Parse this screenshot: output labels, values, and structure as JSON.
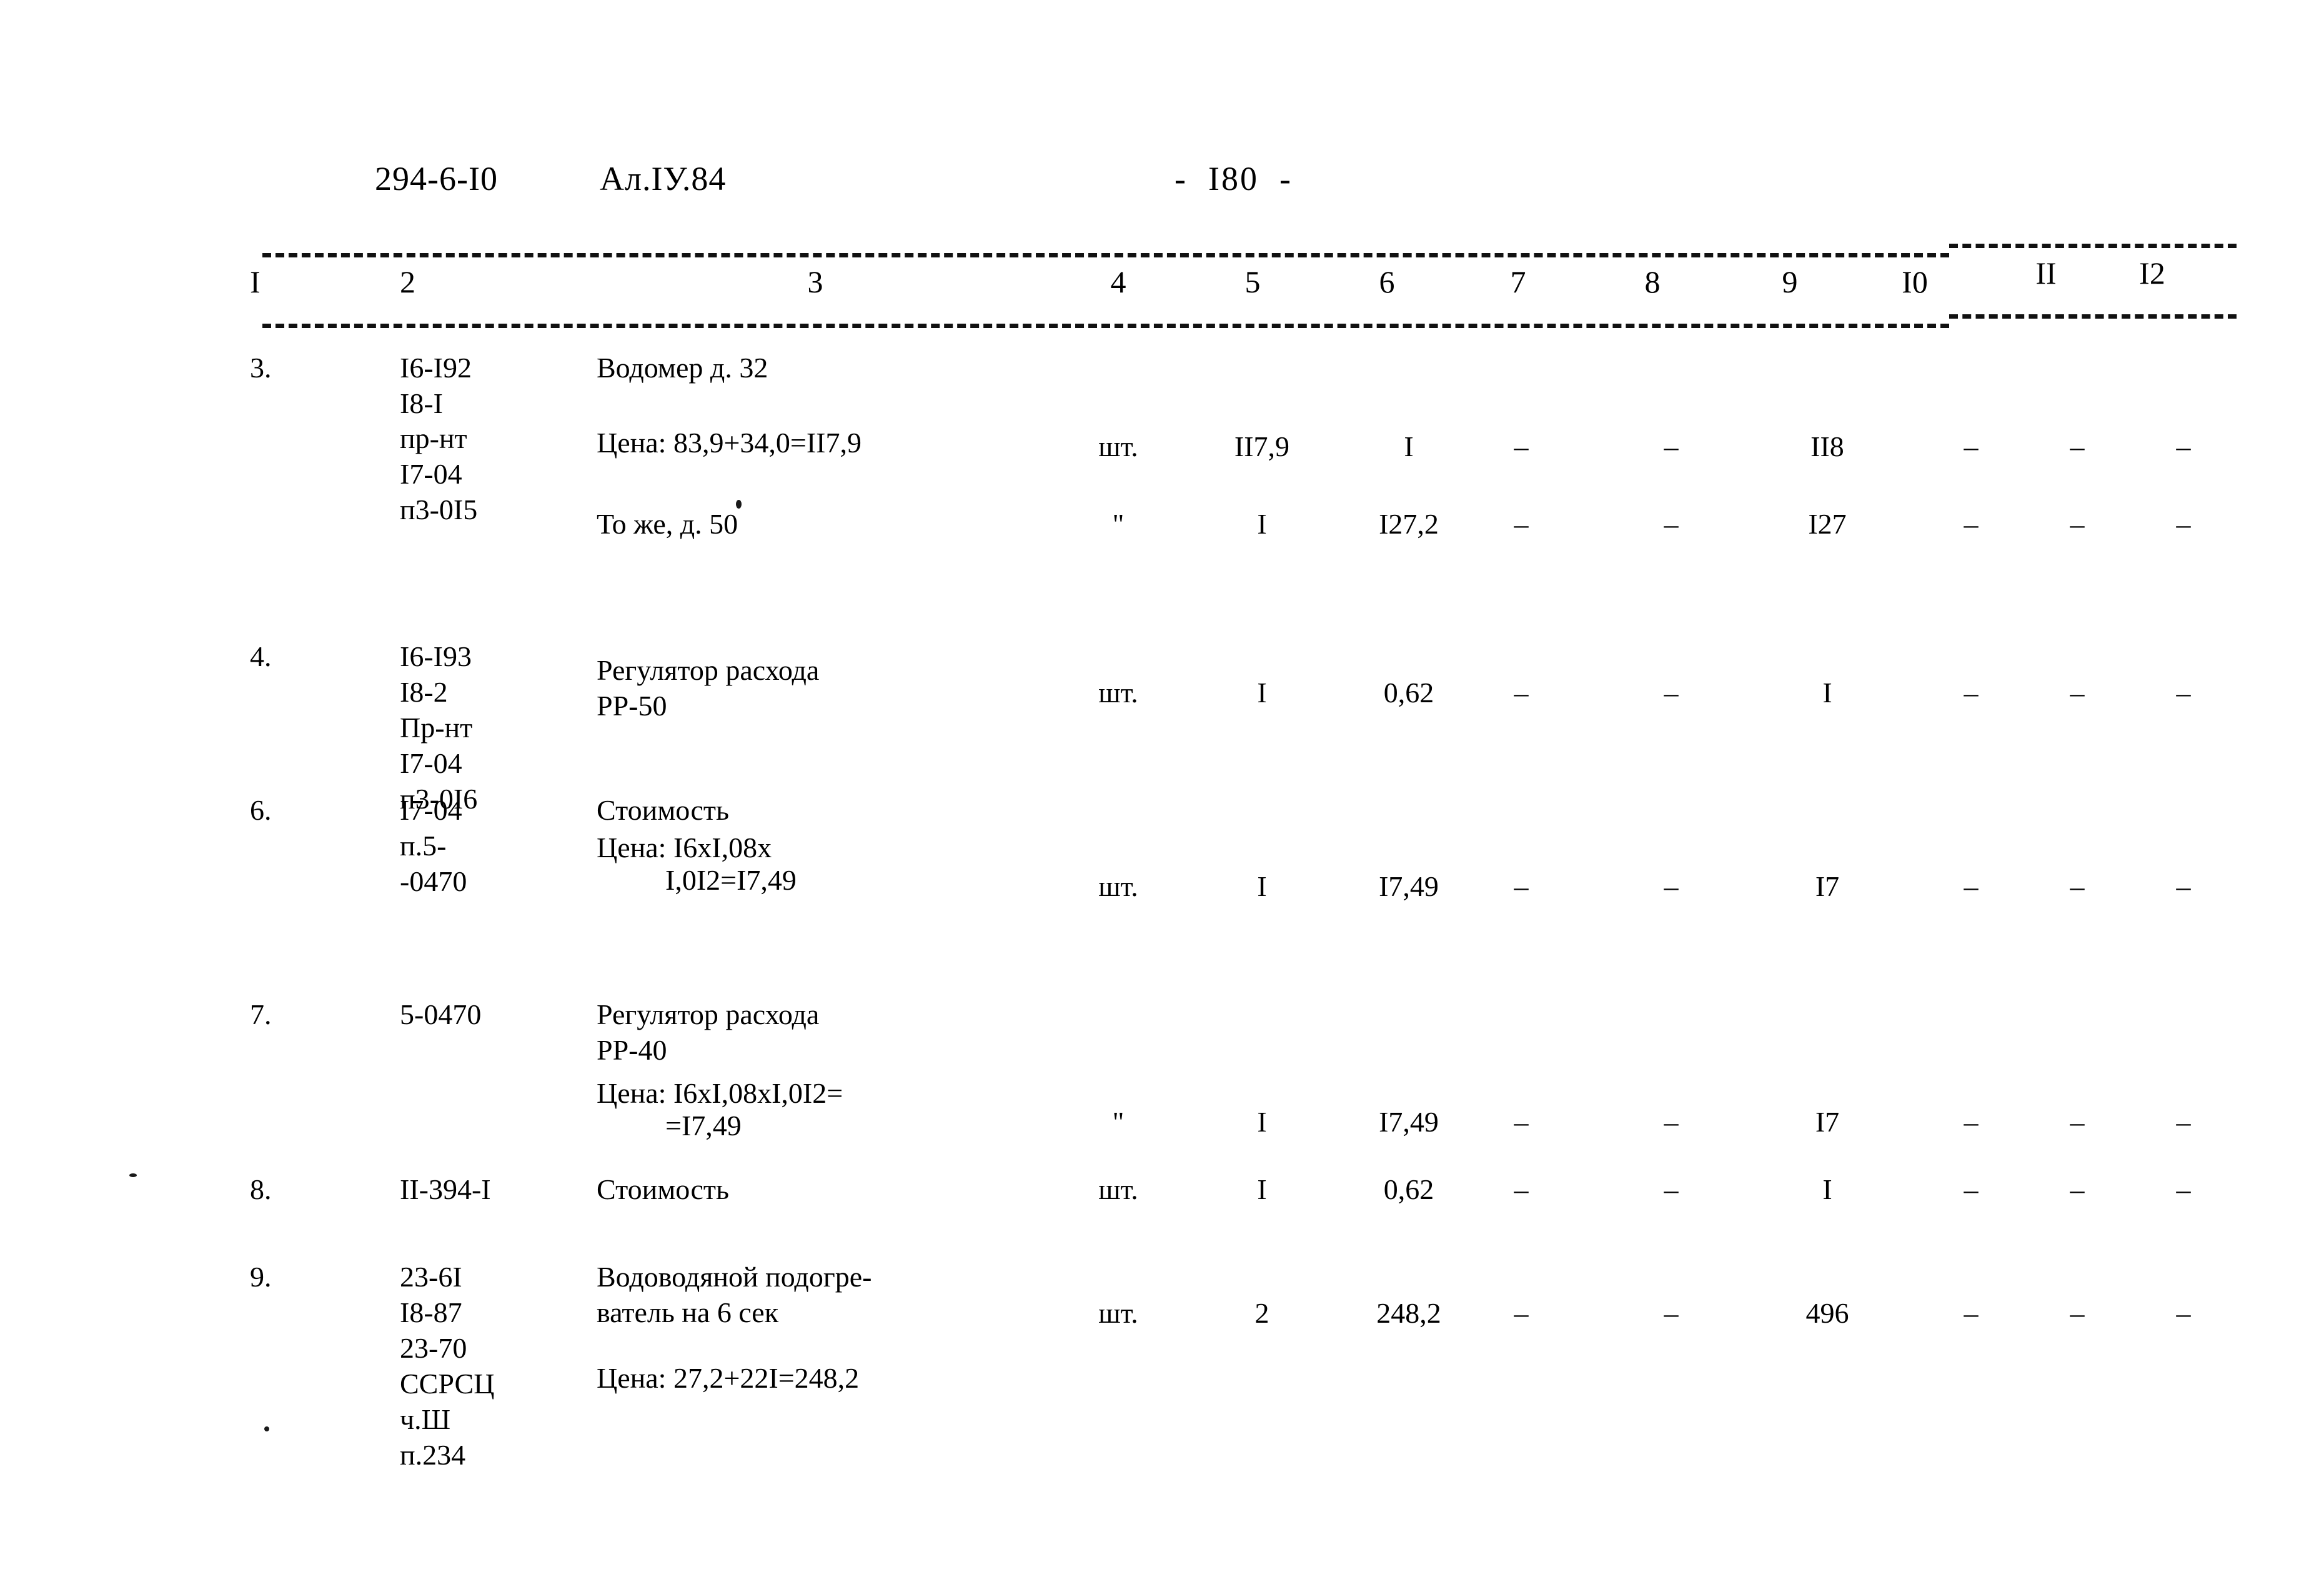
{
  "header": {
    "doc_code": "294-6-I0",
    "album": "Ал.IУ.84",
    "page_number": "-  I80  -"
  },
  "table": {
    "column_headers": [
      "I",
      "2",
      "3",
      "4",
      "5",
      "6",
      "7",
      "8",
      "9",
      "I0",
      "II",
      "I2"
    ],
    "rows": [
      {
        "num": "3.",
        "code": "I6-I92\nI8-I",
        "code2": "пр-нт\nI7-04\nп3-0I5",
        "desc": "Водомер д. 32",
        "desc2": "Цена: 83,9+34,0=II7,9",
        "unit": "шт.",
        "c5": "II7,9",
        "c6": "I",
        "c7": "–",
        "c8": "–",
        "c9": "II8",
        "c10": "–",
        "c11": "–",
        "c12": "–"
      },
      {
        "num": "",
        "code": "",
        "desc": "То же, д. 50",
        "unit": "\"",
        "c5": "I",
        "c6": "I27,2",
        "c7": "–",
        "c8": "–",
        "c9": "I27",
        "c10": "–",
        "c11": "–",
        "c12": "–"
      },
      {
        "num": "4.",
        "code": "I6-I93\nI8-2\nПр-нт\nI7-04\nп3-0I6",
        "desc": "Регулятор расхода\nРР-50",
        "unit": "шт.",
        "c5": "I",
        "c6": "0,62",
        "c7": "–",
        "c8": "–",
        "c9": "I",
        "c10": "–",
        "c11": "–",
        "c12": "–"
      },
      {
        "num": "6.",
        "code": "I7-04\nп.5-\n-0470",
        "desc": "Стоимость",
        "desc2": "Цена: I6xI,08x",
        "desc3": "I,0I2=I7,49",
        "unit": "шт.",
        "c5": "I",
        "c6": "I7,49",
        "c7": "–",
        "c8": "–",
        "c9": "I7",
        "c10": "–",
        "c11": "–",
        "c12": "–"
      },
      {
        "num": "7.",
        "code": "5-0470",
        "desc": "Регулятор расхода\nРР-40",
        "desc2": "Цена: I6xI,08xI,0I2=",
        "desc3": "=I7,49",
        "unit": "\"",
        "c5": "I",
        "c6": "I7,49",
        "c7": "–",
        "c8": "–",
        "c9": "I7",
        "c10": "–",
        "c11": "–",
        "c12": "–"
      },
      {
        "num": "8.",
        "code": "II-394-I",
        "desc": "Стоимость",
        "unit": "шт.",
        "c5": "I",
        "c6": "0,62",
        "c7": "–",
        "c8": "–",
        "c9": "I",
        "c10": "–",
        "c11": "–",
        "c12": "–"
      },
      {
        "num": "9.",
        "code": "23-6I\nI8-87\n23-70\nССРСЦ\nч.Ш\nп.234",
        "desc": "Водоводяной подогре-\nватель на 6 сек",
        "desc2": "Цена: 27,2+22I=248,2",
        "unit": "шт.",
        "c5": "2",
        "c6": "248,2",
        "c7": "–",
        "c8": "–",
        "c9": "496",
        "c10": "–",
        "c11": "–",
        "c12": "–"
      }
    ]
  }
}
